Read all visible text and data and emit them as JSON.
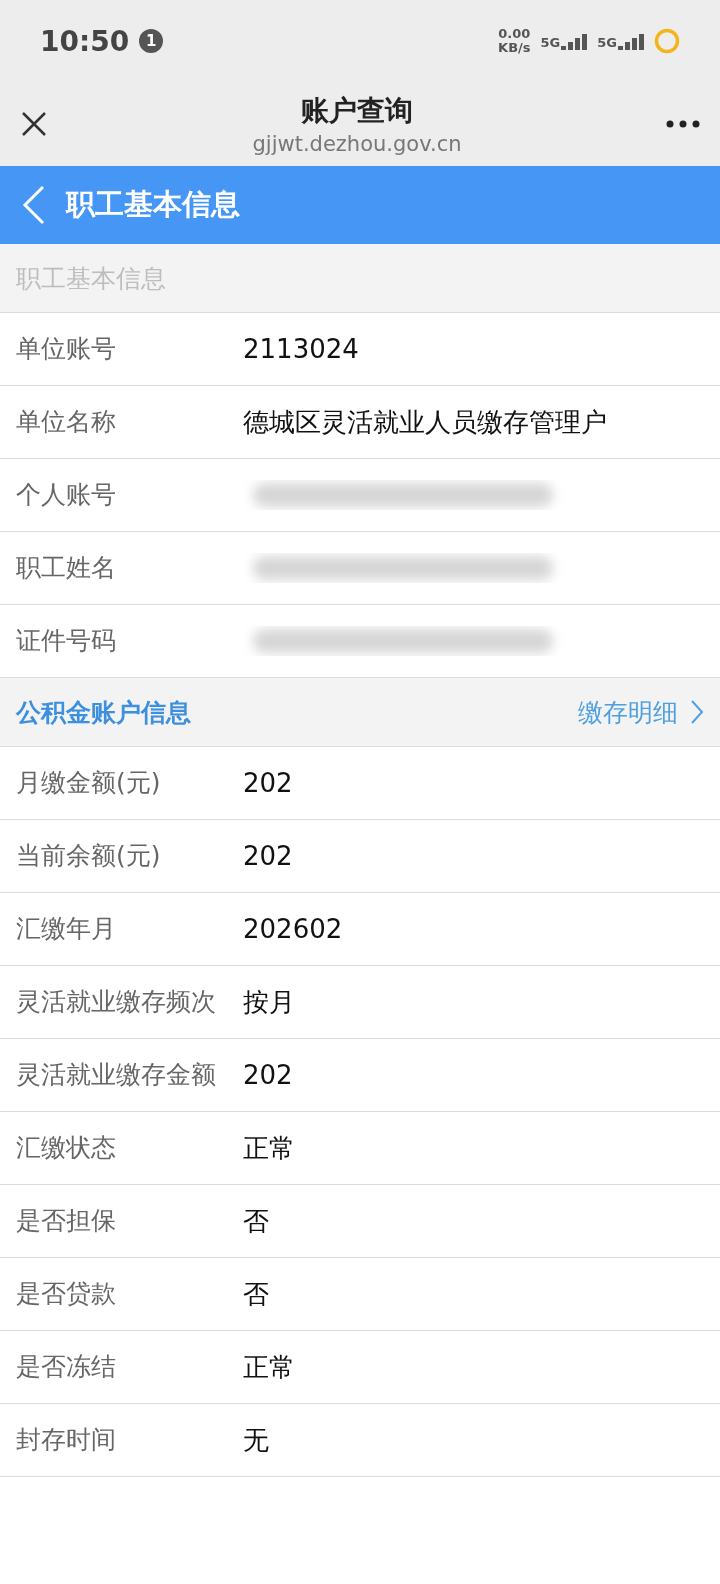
{
  "status_bar": {
    "time": "10:50",
    "notification_count": "1",
    "net_speed": "0.00",
    "net_unit": "KB/s",
    "sim1": "5G",
    "sim2": "5G"
  },
  "header": {
    "title": "账户查询",
    "url": "gjjwt.dezhou.gov.cn"
  },
  "nav": {
    "title": "职工基本信息"
  },
  "sections": [
    {
      "title": "职工基本信息",
      "kind": "muted",
      "rows": [
        {
          "label": "单位账号",
          "value": "2113024",
          "redacted": false
        },
        {
          "label": "单位名称",
          "value": "德城区灵活就业人员缴存管理户",
          "redacted": false
        },
        {
          "label": "个人账号",
          "redacted": true
        },
        {
          "label": "职工姓名",
          "redacted": true
        },
        {
          "label": "证件号码",
          "redacted": true
        }
      ]
    },
    {
      "title": "公积金账户信息",
      "kind": "accent",
      "link": "缴存明细",
      "rows": [
        {
          "label": "月缴金额(元)",
          "value": "202",
          "redacted": false
        },
        {
          "label": "当前余额(元)",
          "value": "202",
          "redacted": false
        },
        {
          "label": "汇缴年月",
          "value": "202602",
          "redacted": false
        },
        {
          "label": "灵活就业缴存频次",
          "value": "按月",
          "redacted": false
        },
        {
          "label": "灵活就业缴存金额",
          "value": "202",
          "redacted": false
        },
        {
          "label": "汇缴状态",
          "value": "正常",
          "redacted": false
        },
        {
          "label": "是否担保",
          "value": "否",
          "redacted": false
        },
        {
          "label": "是否贷款",
          "value": "否",
          "redacted": false
        },
        {
          "label": "是否冻结",
          "value": "正常",
          "redacted": false
        },
        {
          "label": "封存时间",
          "value": "无",
          "redacted": false
        }
      ]
    }
  ]
}
